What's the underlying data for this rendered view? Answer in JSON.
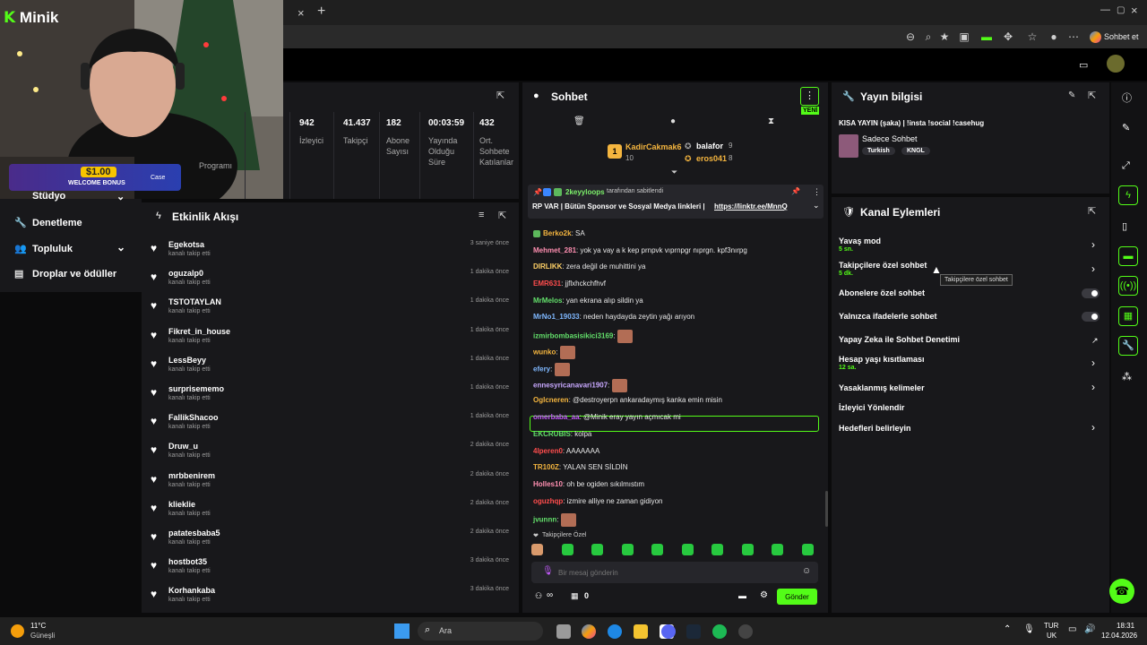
{
  "browser": {
    "new_tab": "+",
    "close_tab": "×",
    "profile_label": "Sohbet et"
  },
  "overlay": {
    "logo": "Minik",
    "bonus_amount": "$1.00",
    "bonus_text": "WELCOME BONUS",
    "bonus_brand": "Case"
  },
  "nav": {
    "items": [
      {
        "label": "Stüdyo"
      },
      {
        "label": "Denetleme"
      },
      {
        "label": "Topluluk"
      },
      {
        "label": "Droplar ve ödüller"
      }
    ],
    "program_label": "Programı"
  },
  "stats": [
    {
      "value": "942",
      "label": "İzleyici"
    },
    {
      "value": "41.437",
      "label": "Takipçi"
    },
    {
      "value": "182",
      "label": "Abone Sayısı"
    },
    {
      "value": "00:03:59",
      "label": "Yayında Olduğu Süre"
    },
    {
      "value": "432",
      "label": "Ort. Sohbete Katılanlar"
    }
  ],
  "activity": {
    "title": "Etkinlik Akışı",
    "subtitle": "kanalı takip etti",
    "items": [
      {
        "name": "Egekotsa",
        "time": "3 saniye önce"
      },
      {
        "name": "oguzalp0",
        "time": "1 dakika önce"
      },
      {
        "name": "TSTOTAYLAN",
        "time": "1 dakika önce"
      },
      {
        "name": "Fikret_in_house",
        "time": "1 dakika önce"
      },
      {
        "name": "LessBeyy",
        "time": "1 dakika önce"
      },
      {
        "name": "surprisememo",
        "time": "1 dakika önce"
      },
      {
        "name": "FallikShacoo",
        "time": "1 dakika önce"
      },
      {
        "name": "Druw_u",
        "time": "2 dakika önce"
      },
      {
        "name": "mrbbenirem",
        "time": "2 dakika önce"
      },
      {
        "name": "klieklie",
        "time": "2 dakika önce"
      },
      {
        "name": "patatesbaba5",
        "time": "2 dakika önce"
      },
      {
        "name": "hostbot35",
        "time": "3 dakika önce"
      },
      {
        "name": "Korhankaba",
        "time": "3 dakika önce"
      }
    ]
  },
  "chat": {
    "title": "Sohbet",
    "new_badge": "YENİ",
    "top_gifter": {
      "rank": "1",
      "name": "KadirCakmak6",
      "count": "10"
    },
    "gifters": [
      {
        "name": "balafor",
        "count": "9"
      },
      {
        "name": "eros041",
        "count": "8"
      }
    ],
    "pinned_by_user": "2keyyloops",
    "pinned_by_text": "tarafından sabitlendi",
    "pinned_message": "RP VAR | Bütün Sponsor ve Sosyal Medya linkleri |",
    "pinned_link": "https://linktr.ee/MnnQ",
    "messages": [
      {
        "user": "Berko2k",
        "color": "#f4b53f",
        "text": "SA"
      },
      {
        "user": "Mehmet_281",
        "color": "#ff8fb1",
        "text": "yok ya vay a k kep prnpvk vıprnpgr nıprgn. kpf3nırpg"
      },
      {
        "user": "DIRLIKK",
        "color": "#ffd166",
        "text": "zera değil de muhittini ya"
      },
      {
        "user": "EMR631",
        "color": "#ff4d4d",
        "text": "jjflxhckchfhvf"
      },
      {
        "user": "MrMelos",
        "color": "#63e06b",
        "text": "yan ekrana alıp sildin ya"
      },
      {
        "user": "MrNo1_19033",
        "color": "#7fb8ff",
        "text": "neden haydayda zeytin yağı arıyon"
      },
      {
        "user": "izmirbombasisikici3169",
        "color": "#63e06b",
        "text": ""
      },
      {
        "user": "wunko",
        "color": "#f4b53f",
        "text": ""
      },
      {
        "user": "efery",
        "color": "#7fb8ff",
        "text": ""
      },
      {
        "user": "ennesyricanavari1907",
        "color": "#c8a8ff",
        "text": ""
      },
      {
        "user": "Oglcneren",
        "color": "#f4b53f",
        "text": "@destroyerpn ankaradaymış kanka emin misin"
      },
      {
        "user": "omerbaba_aa",
        "color": "#c65cff",
        "text": "@Minik eray yayın açmıcak mi"
      },
      {
        "user": "EKCRUBIS",
        "color": "#63e06b",
        "text": "kolpa"
      },
      {
        "user": "4lperen0",
        "color": "#ff4d4d",
        "text": "AAAAAAA"
      },
      {
        "user": "TR100Z",
        "color": "#f4b53f",
        "text": "YALAN SEN SİLDİN"
      },
      {
        "user": "Holles10",
        "color": "#ff8fb1",
        "text": "oh be ogiden sıkılmıstım"
      },
      {
        "user": "oguzhqp",
        "color": "#ff4d4d",
        "text": "izmire alliye ne zaman gidiyon"
      },
      {
        "user": "jvunnn",
        "color": "#63e06b",
        "text": ""
      }
    ],
    "followers_only": "Takipçilere Özel",
    "input_placeholder": "Bir mesaj gönderin",
    "infinity": "∞",
    "count_zero": "0",
    "send_label": "Gönder"
  },
  "stream_info": {
    "title": "Yayın bilgisi",
    "stream_title": "KISA YAYIN (şaka) | !insta !social !casehug",
    "category": "Sadece Sohbet",
    "tags": [
      "Turkish",
      "KNGL"
    ]
  },
  "channel_actions": {
    "title": "Kanal Eylemleri",
    "items": [
      {
        "label": "Yavaş mod",
        "sub": "5 sn.",
        "control": "chevron"
      },
      {
        "label": "Takipçilere özel sohbet",
        "sub": "5 dk.",
        "control": "chevron"
      },
      {
        "label": "Abonelere özel sohbet",
        "sub": "",
        "control": "toggle"
      },
      {
        "label": "Yalnızca ifadelerle sohbet",
        "sub": "",
        "control": "toggle"
      },
      {
        "label": "Yapay Zeka ile Sohbet Denetimi",
        "sub": "",
        "control": "external"
      },
      {
        "label": "Hesap yaşı kısıtlaması",
        "sub": "12 sa.",
        "control": "chevron"
      },
      {
        "label": "Yasaklanmış kelimeler",
        "sub": "",
        "control": "chevron"
      },
      {
        "label": "İzleyici Yönlendir",
        "sub": "",
        "control": "none"
      },
      {
        "label": "Hedefleri belirleyin",
        "sub": "",
        "control": "chevron"
      }
    ],
    "tooltip": "Takipçilere özel sohbet"
  },
  "taskbar": {
    "weather_temp": "11°C",
    "weather_desc": "Güneşli",
    "search_placeholder": "Ara",
    "lang_top": "TUR",
    "lang_bottom": "UK",
    "time": "18:31",
    "date": "12.04.2026"
  },
  "colors": {
    "accent": "#53fc18",
    "panel": "#18181b",
    "background": "#0b0b0c"
  }
}
